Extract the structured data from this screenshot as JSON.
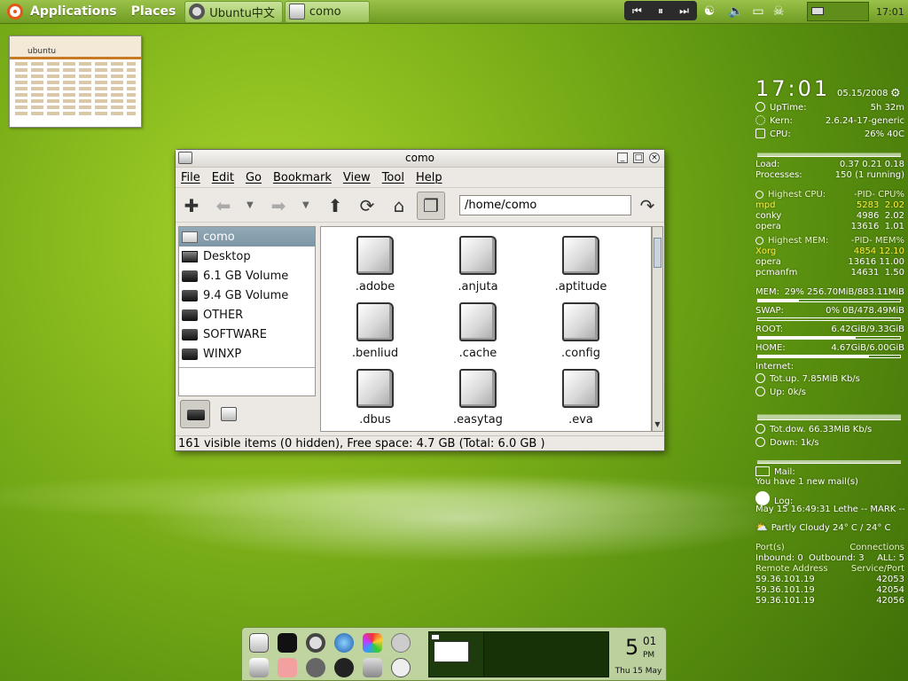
{
  "top_panel": {
    "applications_label": "Applications",
    "places_label": "Places",
    "tasks": [
      {
        "label": "Ubuntu中文",
        "icon": "opera-icon"
      },
      {
        "label": "como",
        "icon": "folder-icon"
      }
    ],
    "clock": "17:01"
  },
  "thumbnail": {
    "site_label": "ubuntu"
  },
  "file_manager": {
    "title": "como",
    "menu": [
      "File",
      "Edit",
      "Go",
      "Bookmark",
      "View",
      "Tool",
      "Help"
    ],
    "path": "/home/como",
    "places": [
      {
        "label": "como",
        "icon": "home-folder-icon",
        "selected": true
      },
      {
        "label": "Desktop",
        "icon": "desktop-icon"
      },
      {
        "label": "6.1 GB Volume",
        "icon": "drive-icon"
      },
      {
        "label": "9.4 GB Volume",
        "icon": "drive-icon"
      },
      {
        "label": "OTHER",
        "icon": "drive-icon"
      },
      {
        "label": "SOFTWARE",
        "icon": "drive-icon"
      },
      {
        "label": "WINXP",
        "icon": "drive-icon"
      }
    ],
    "files": [
      ".adobe",
      ".anjuta",
      ".aptitude",
      ".benliud",
      ".cache",
      ".config",
      ".dbus",
      ".easytag",
      ".eva"
    ],
    "status": "161 visible items (0 hidden), Free space: 4.7 GB (Total: 6.0 GB )"
  },
  "conky": {
    "time": "17:01",
    "date": "05.15/2008",
    "uptime_label": "UpTime:",
    "uptime": "5h 32m",
    "kern_label": "Kern:",
    "kern": "2.6.24-17-generic",
    "cpu_label": "CPU:",
    "cpu": "26% 40C",
    "load_label": "Load:",
    "load": "0.37 0.21 0.18",
    "processes_label": "Processes:",
    "processes": "150  (1 running)",
    "highest_cpu_label": "Highest CPU:",
    "cpu_cols": "-PID-  CPU%",
    "top_cpu": [
      {
        "name": "mpd",
        "pid": "5283",
        "val": "2.02",
        "highlight": true
      },
      {
        "name": "conky",
        "pid": "4986",
        "val": "2.02"
      },
      {
        "name": "opera",
        "pid": "13616",
        "val": "1.01"
      }
    ],
    "highest_mem_label": "Highest MEM:",
    "mem_cols": "-PID-  MEM%",
    "top_mem": [
      {
        "name": "Xorg",
        "pid": "4854",
        "val": "12.10",
        "highlight": true
      },
      {
        "name": "opera",
        "pid": "13616",
        "val": "11.00"
      },
      {
        "name": "pcmanfm",
        "pid": "14631",
        "val": "1.50"
      }
    ],
    "mem_label": "MEM:",
    "mem": "29% 256.70MiB/883.11MiB",
    "mem_fraction": 0.29,
    "swap_label": "SWAP:",
    "swap": "0% 0B/478.49MiB",
    "swap_fraction": 0.0,
    "root_label": "ROOT:",
    "root": "6.42GiB/9.33GiB",
    "root_fraction": 0.69,
    "home_label": "HOME:",
    "home": "4.67GiB/6.00GiB",
    "home_fraction": 0.78,
    "internet_label": "Internet:",
    "totup_1": "Tot.up. 7.85MiB Kb/s",
    "up": "Up: 0k/s",
    "totdown": "Tot.dow. 66.33MiB Kb/s",
    "down": "Down: 1k/s",
    "mail_label": "Mail:",
    "mail": "You have 1 new mail(s)",
    "log_label": "Log:",
    "log": "May 15 16:49:31 Lethe -- MARK --",
    "weather": "Partly Cloudy 24° C / 24° C",
    "ports_label": "Port(s)",
    "connections_label": "Connections",
    "inbound": "Inbound: 0",
    "outbound": "Outbound: 3",
    "all": "ALL: 5",
    "remote_label": "Remote Address",
    "service_label": "Service/Port",
    "connections": [
      {
        "addr": "59.36.101.19",
        "port": "42053"
      },
      {
        "addr": "59.36.101.19",
        "port": "42054"
      },
      {
        "addr": "59.36.101.19",
        "port": "42056"
      }
    ]
  },
  "dock": {
    "hour": "5",
    "minute": "01",
    "ampm": "PM",
    "date": "Thu 15 May"
  }
}
